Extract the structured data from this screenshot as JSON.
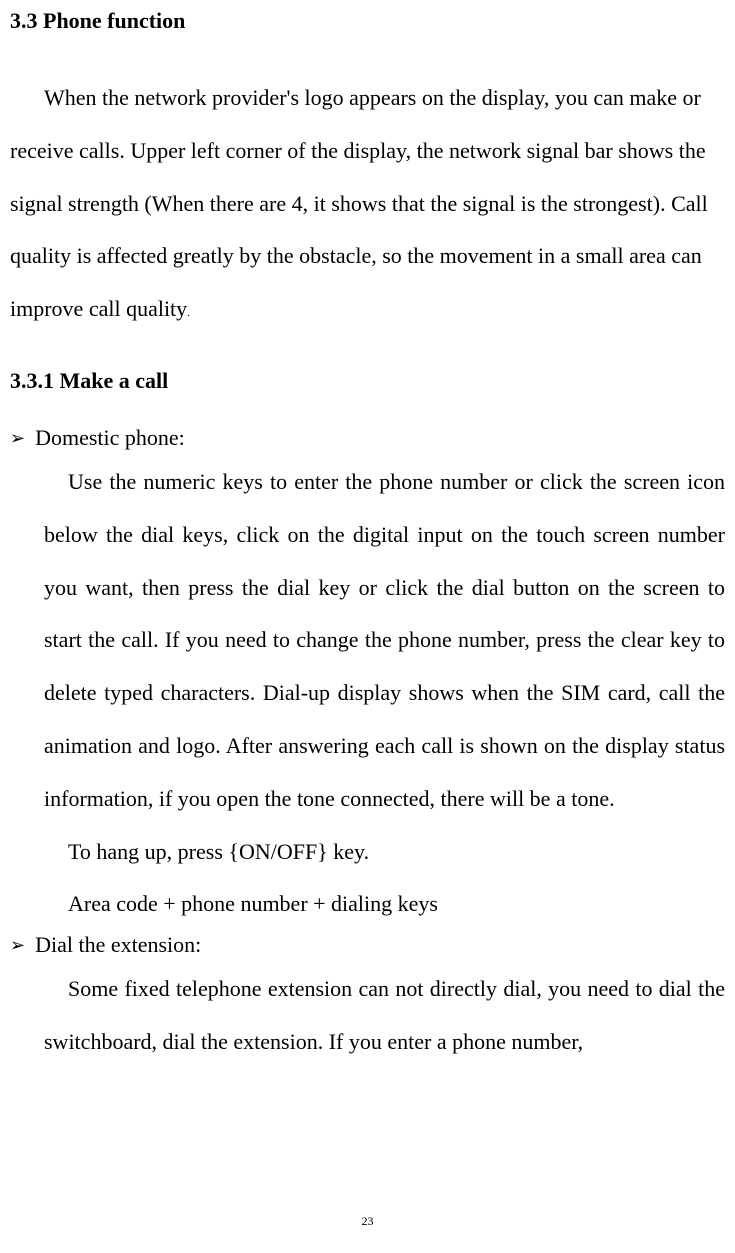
{
  "section": {
    "heading": "3.3 Phone function",
    "intro": "When the network provider's logo appears on the display, you can make or receive calls. Upper left corner of the display, the network signal bar shows the signal strength (When there are 4, it shows that the signal is the strongest). Call quality is affected greatly by the obstacle, so the movement in a small area can improve call quality"
  },
  "subsection": {
    "heading": "3.3.1 Make a call"
  },
  "bullets": [
    {
      "label": "Domestic phone:",
      "body": "Use the numeric keys to enter the phone number or click the screen icon below the dial keys, click on the digital input on the touch screen number you want, then press the dial key or click the dial button on the screen to start the call. If you need to change the phone number, press the clear key to delete typed characters. Dial-up display shows when the SIM card, call the animation and logo. After answering each call is shown on the display status information, if you open the tone connected, there will be a tone.",
      "line2": "To hang up, press {ON/OFF} key.",
      "line3": "Area code + phone number + dialing keys"
    },
    {
      "label": "Dial the extension:",
      "body": "Some fixed telephone extension can not directly dial, you need to dial the switchboard, dial the extension. If you enter a phone number,"
    }
  ],
  "pageNumber": "23"
}
